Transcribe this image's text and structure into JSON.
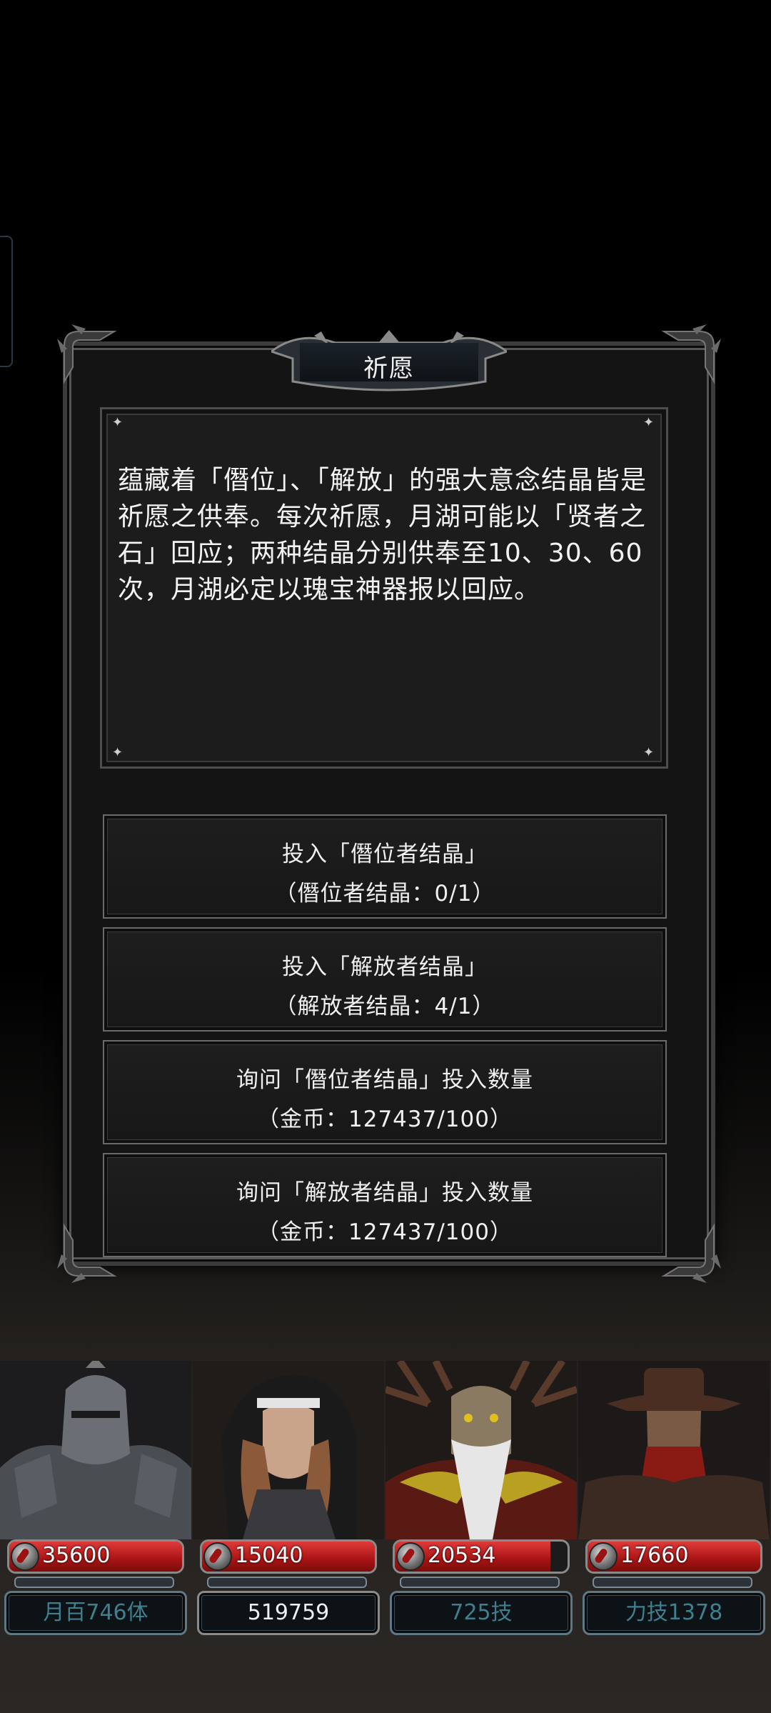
{
  "dialog": {
    "title": "祈愿",
    "description": "蕴藏着「僭位」、「解放」的强大意念结晶皆是祈愿之供奉。每次祈愿，月湖可能以「贤者之石」回应；两种结晶分别供奉至10、30、60次，月湖必定以瑰宝神器报以回应。",
    "options": [
      {
        "line1": "投入「僭位者结晶」",
        "line2": "（僭位者结晶：0/1）"
      },
      {
        "line1": "投入「解放者结晶」",
        "line2": "（解放者结晶：4/1）"
      },
      {
        "line1": "询问「僭位者结晶」投入数量",
        "line2": "（金币：127437/100）"
      },
      {
        "line1": "询问「解放者结晶」投入数量",
        "line2": "（金币：127437/100）"
      }
    ]
  },
  "party": [
    {
      "hp": "35600",
      "hp_fraction": 1.0,
      "tag": "月百746体",
      "tag_style": "teal",
      "portrait_icon": "armored-knight-portrait"
    },
    {
      "hp": "15040",
      "hp_fraction": 1.0,
      "tag": "519759",
      "tag_style": "white",
      "portrait_icon": "nun-portrait"
    },
    {
      "hp": "20534",
      "hp_fraction": 0.9,
      "tag": "725技",
      "tag_style": "teal",
      "portrait_icon": "antlered-elder-portrait"
    },
    {
      "hp": "17660",
      "hp_fraction": 1.0,
      "tag": "力技1378",
      "tag_style": "teal",
      "portrait_icon": "gunslinger-portrait"
    }
  ],
  "colors": {
    "hp_red": "#b01818",
    "tag_teal": "#3f7f8e",
    "frame_gray": "#4d4d4d"
  }
}
